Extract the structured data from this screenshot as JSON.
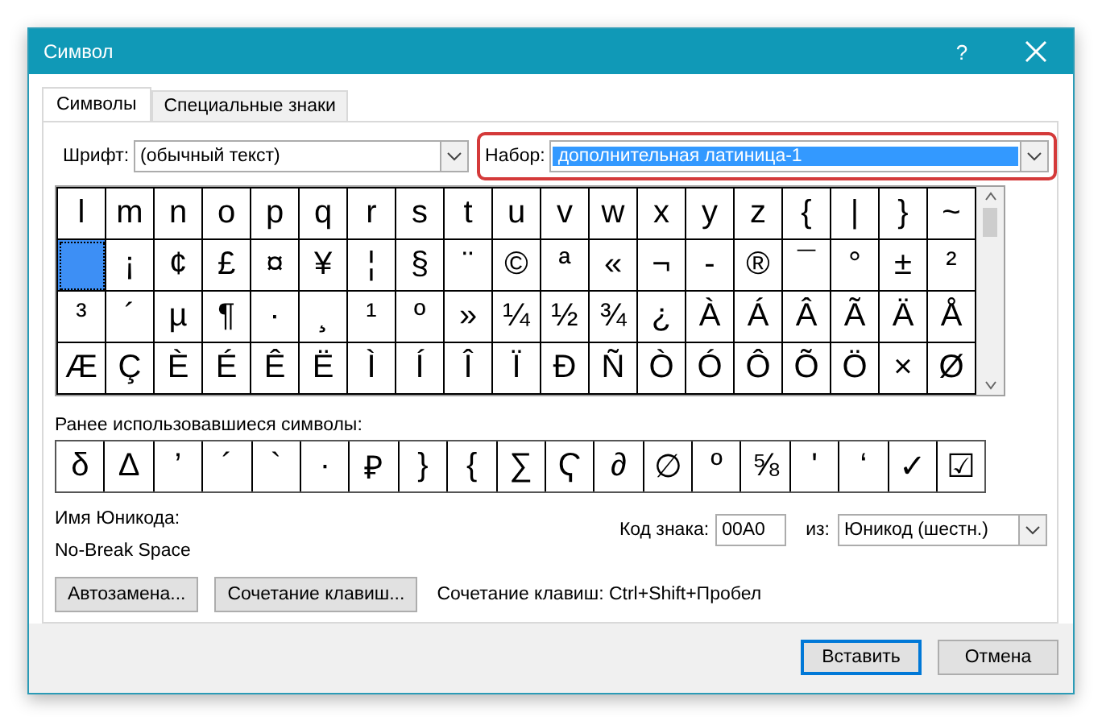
{
  "window": {
    "title": "Символ",
    "help": "?"
  },
  "tabs": [
    {
      "label": "Символы",
      "selected": true
    },
    {
      "label": "Специальные знаки",
      "selected": false
    }
  ],
  "font": {
    "label": "Шрифт:",
    "value": "(обычный текст)"
  },
  "subset": {
    "label": "Набор:",
    "value": "дополнительная латиница-1",
    "highlighted": true
  },
  "grid": [
    [
      {
        "char": "l",
        "selected": false
      },
      {
        "char": "m",
        "selected": false
      },
      {
        "char": "n",
        "selected": false
      },
      {
        "char": "o",
        "selected": false
      },
      {
        "char": "p",
        "selected": false
      },
      {
        "char": "q",
        "selected": false
      },
      {
        "char": "r",
        "selected": false
      },
      {
        "char": "s",
        "selected": false
      },
      {
        "char": "t",
        "selected": false
      },
      {
        "char": "u",
        "selected": false
      },
      {
        "char": "v",
        "selected": false
      },
      {
        "char": "w",
        "selected": false
      },
      {
        "char": "x",
        "selected": false
      },
      {
        "char": "y",
        "selected": false
      },
      {
        "char": "z",
        "selected": false
      },
      {
        "char": "{",
        "selected": false
      },
      {
        "char": "|",
        "selected": false
      },
      {
        "char": "}",
        "selected": false
      },
      {
        "char": "~",
        "selected": false
      }
    ],
    [
      {
        "selected": true
      },
      {
        "char": "¡",
        "selected": false
      },
      {
        "char": "¢",
        "selected": false
      },
      {
        "char": "£",
        "selected": false
      },
      {
        "char": "¤",
        "selected": false
      },
      {
        "char": "¥",
        "selected": false
      },
      {
        "char": "¦",
        "selected": false
      },
      {
        "char": "§",
        "selected": false
      },
      {
        "char": "¨",
        "selected": false
      },
      {
        "char": "©",
        "selected": false
      },
      {
        "char": "ª",
        "selected": false
      },
      {
        "char": "«",
        "selected": false
      },
      {
        "char": "¬",
        "selected": false
      },
      {
        "char": "-",
        "selected": false
      },
      {
        "char": "®",
        "selected": false
      },
      {
        "char": "¯",
        "selected": false
      },
      {
        "char": "°",
        "selected": false
      },
      {
        "char": "±",
        "selected": false
      },
      {
        "char": "²",
        "selected": false
      }
    ],
    [
      {
        "char": "³",
        "selected": false
      },
      {
        "char": "´",
        "selected": false
      },
      {
        "char": "µ",
        "selected": false
      },
      {
        "char": "¶",
        "selected": false
      },
      {
        "char": "·",
        "selected": false
      },
      {
        "char": "¸",
        "selected": false
      },
      {
        "char": "¹",
        "selected": false
      },
      {
        "char": "º",
        "selected": false
      },
      {
        "char": "»",
        "selected": false
      },
      {
        "char": "¼",
        "selected": false
      },
      {
        "char": "½",
        "selected": false
      },
      {
        "char": "¾",
        "selected": false
      },
      {
        "char": "¿",
        "selected": false
      },
      {
        "char": "À",
        "selected": false
      },
      {
        "char": "Á",
        "selected": false
      },
      {
        "char": "Â",
        "selected": false
      },
      {
        "char": "Ã",
        "selected": false
      },
      {
        "char": "Ä",
        "selected": false
      },
      {
        "char": "Å",
        "selected": false
      }
    ],
    [
      {
        "char": "Æ",
        "selected": false
      },
      {
        "char": "Ç",
        "selected": false
      },
      {
        "char": "È",
        "selected": false
      },
      {
        "char": "É",
        "selected": false
      },
      {
        "char": "Ê",
        "selected": false
      },
      {
        "char": "Ë",
        "selected": false
      },
      {
        "char": "Ì",
        "selected": false
      },
      {
        "char": "Í",
        "selected": false
      },
      {
        "char": "Î",
        "selected": false
      },
      {
        "char": "Ï",
        "selected": false
      },
      {
        "char": "Ð",
        "selected": false
      },
      {
        "char": "Ñ",
        "selected": false
      },
      {
        "char": "Ò",
        "selected": false
      },
      {
        "char": "Ó",
        "selected": false
      },
      {
        "char": "Ô",
        "selected": false
      },
      {
        "char": "Õ",
        "selected": false
      },
      {
        "char": "Ö",
        "selected": false
      },
      {
        "char": "×",
        "selected": false
      },
      {
        "char": "Ø",
        "selected": false
      }
    ]
  ],
  "recent": {
    "label": "Ранее использовавшиеся символы:",
    "symbols": [
      "δ",
      "Δ",
      "’",
      "´",
      "`",
      "·",
      "₽",
      "}",
      "{",
      "∑",
      "Ҁ",
      "∂",
      "∅",
      "º",
      "⅝",
      "'",
      "‘",
      "✓",
      "☑"
    ]
  },
  "unicode_name": {
    "label": "Имя Юникода:",
    "value": "No-Break Space"
  },
  "char_code": {
    "label": "Код знака:",
    "value": "00A0"
  },
  "from": {
    "label": "из:",
    "value": "Юникод (шестн.)"
  },
  "buttons": [
    {
      "label": "Автозамена..."
    },
    {
      "label": "Сочетание клавиш..."
    }
  ],
  "shortcut": "Сочетание клавиш: Ctrl+Shift+Пробел",
  "footer_buttons": [
    {
      "label": "Вставить",
      "default": true
    },
    {
      "label": "Отмена",
      "default": false
    }
  ]
}
